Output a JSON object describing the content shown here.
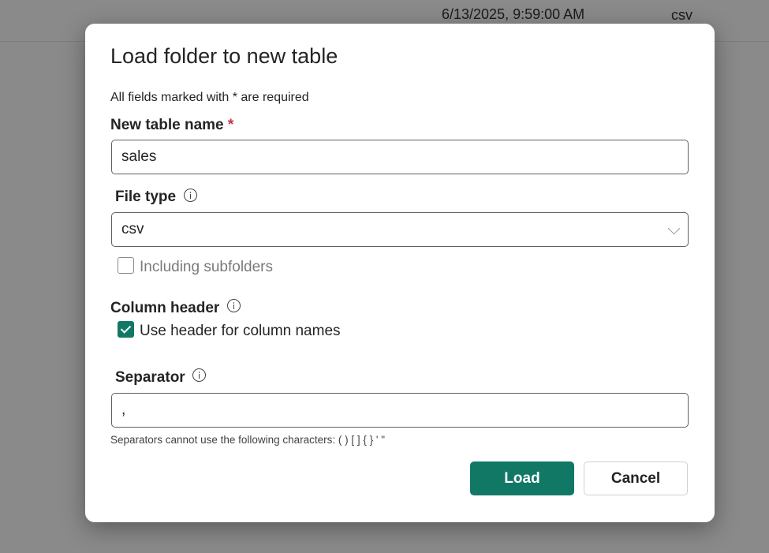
{
  "background": {
    "date": "6/13/2025, 9:59:00 AM",
    "file_type": "csv"
  },
  "dialog": {
    "title": "Load folder to new table",
    "required_note": "All fields marked with * are required",
    "table_name": {
      "label": "New table name",
      "required_mark": "*",
      "value": "sales"
    },
    "file_type": {
      "label": "File type",
      "icon": "info-icon",
      "selected": "csv"
    },
    "subfolders": {
      "label": "Including subfolders",
      "checked": false
    },
    "column_header": {
      "label": "Column header",
      "icon": "info-icon",
      "option_label": "Use header for column names",
      "checked": true
    },
    "separator": {
      "label": "Separator",
      "icon": "info-icon",
      "value": ",",
      "hint": "Separators cannot use the following characters: ( ) [ ] { } ' \""
    },
    "load_button": "Load",
    "cancel_button": "Cancel"
  },
  "colors": {
    "accent": "#117865",
    "required": "#c4314b",
    "overlay": "#8a8a8a"
  }
}
